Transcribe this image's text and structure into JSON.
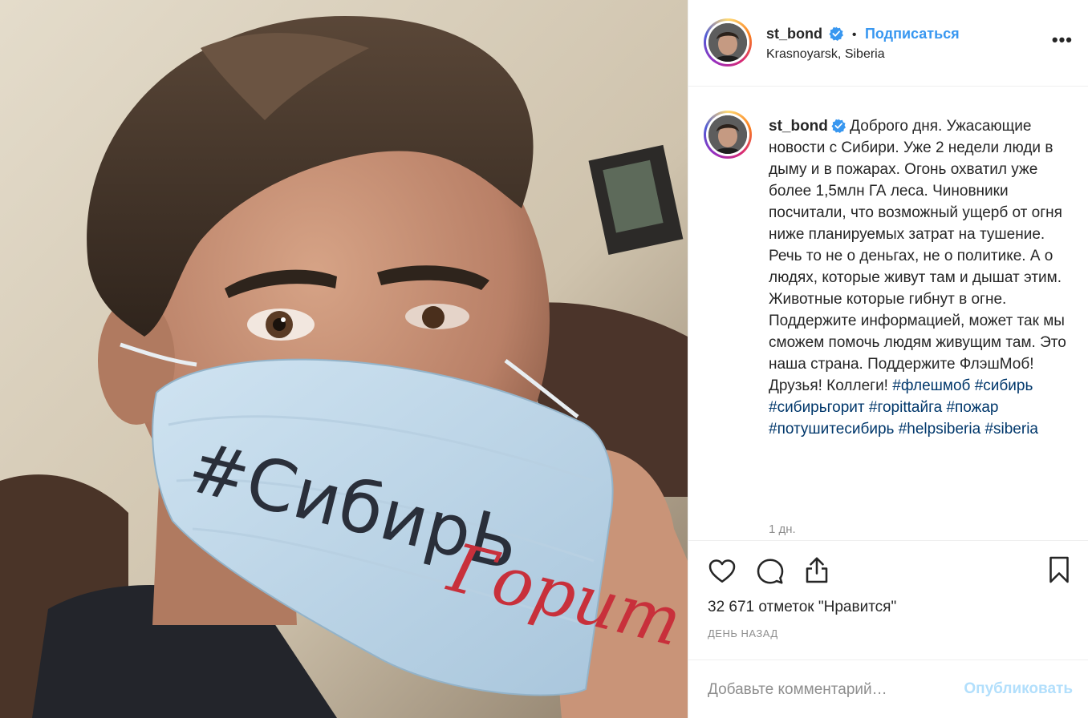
{
  "post": {
    "username": "st_bond",
    "location": "Krasnoyarsk, Siberia",
    "follow_label": "Подписаться",
    "separator": "•",
    "more_label": "•••"
  },
  "caption": {
    "username": "st_bond",
    "text": "Доброго дня. Ужасающие новости с Сибири. Уже 2 недели люди в дыму и в пожарах. Огонь охватил уже более 1,5млн ГА леса. Чиновники посчитали, что возможный ущерб от огня ниже планируемых затрат на тушение. Речь то не о деньгах, не о политике. А о людях, которые живут там и дышат этим. Животные которые гибнут в огне. Поддержите информацией, может так мы сможем помочь людям живущим там. Это наша страна. Поддержите ФлэшМоб! Друзья! Коллеги! ",
    "hashtags": [
      "#флешмоб",
      "#сибирь",
      "#сибирьгорит",
      "#горittайга",
      "#пожар",
      "#потушитесибирь",
      "#helpsiberia",
      "#siberia"
    ],
    "time": "1 дн."
  },
  "actions": {
    "likes": "32 671 отметок \"Нравится\"",
    "ago": "ДЕНЬ НАЗАД"
  },
  "comment": {
    "placeholder": "Добавьте комментарий…",
    "publish_label": "Опубликовать"
  },
  "photo": {
    "mask_text_black": "#СибирЬ",
    "mask_text_red": "Горит"
  },
  "colors": {
    "accent": "#3897f0",
    "hashtag": "#00376b",
    "muted": "#8e8e8e",
    "publish_disabled": "#b2dffc"
  }
}
